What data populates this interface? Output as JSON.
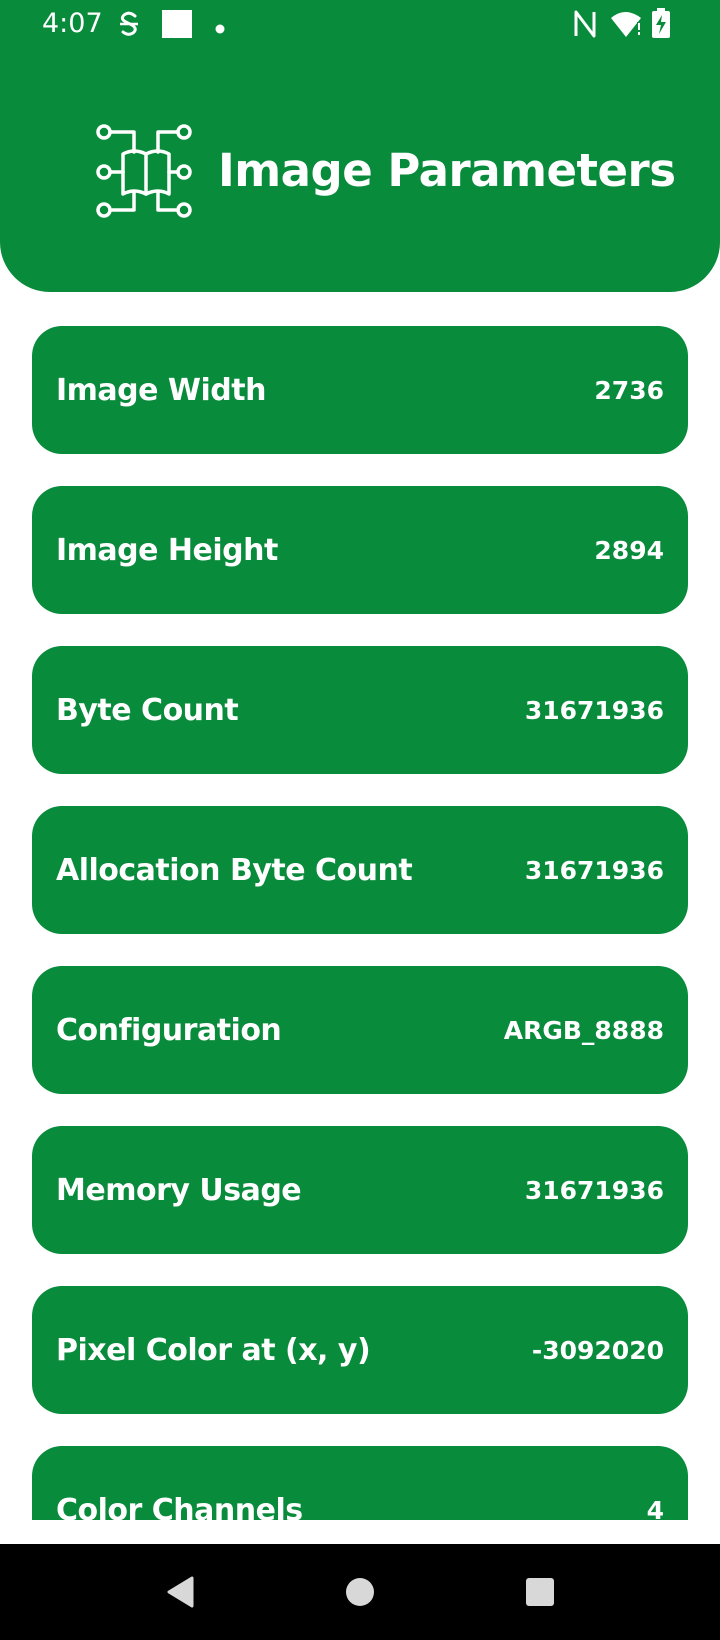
{
  "colors": {
    "accent": "#088b3b",
    "nav_bar": "#000000",
    "text": "#ffffff"
  },
  "status_bar": {
    "time": "4:07",
    "icons": [
      "notification-s-icon",
      "square-notification-icon",
      "dot-icon",
      "nfc-icon",
      "wifi-alert-icon",
      "battery-charging-icon"
    ]
  },
  "header": {
    "title": "Image Parameters",
    "logo_icon": "book-circuit-icon"
  },
  "parameters": [
    {
      "label": "Image Width",
      "value": "2736"
    },
    {
      "label": "Image Height",
      "value": "2894"
    },
    {
      "label": "Byte Count",
      "value": "31671936"
    },
    {
      "label": "Allocation Byte Count",
      "value": "31671936"
    },
    {
      "label": "Configuration",
      "value": "ARGB_8888"
    },
    {
      "label": "Memory Usage",
      "value": "31671936"
    },
    {
      "label": "Pixel Color at (x, y)",
      "value": "-3092020"
    },
    {
      "label": "Color Channels",
      "value": "4"
    }
  ],
  "nav_bar": {
    "buttons": [
      "back-icon",
      "home-icon",
      "recents-icon"
    ]
  }
}
